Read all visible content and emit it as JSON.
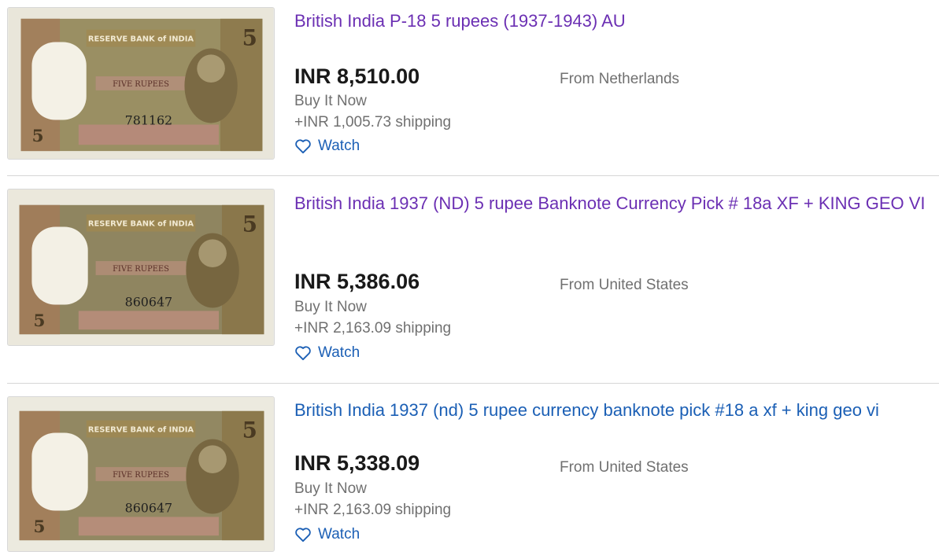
{
  "listings": [
    {
      "title": "British India P-18 5 rupees (1937-1943) AU",
      "price": "INR 8,510.00",
      "buy_format": "Buy It Now",
      "shipping": "+INR 1,005.73 shipping",
      "origin": "From Netherlands",
      "watch_label": "Watch",
      "note_bank_name": "RESERVE BANK of INDIA",
      "note_serial": "781162",
      "note_value_label": "FIVE RUPEES"
    },
    {
      "title": "British India 1937 (ND) 5 rupee Banknote Currency Pick # 18a XF + KING GEO VI",
      "price": "INR 5,386.06",
      "buy_format": "Buy It Now",
      "shipping": "+INR 2,163.09 shipping",
      "origin": "From United States",
      "watch_label": "Watch",
      "note_bank_name": "RESERVE BANK of INDIA",
      "note_serial": "860647",
      "note_value_label": "FIVE RUPEES"
    },
    {
      "title": "British India 1937 (nd) 5 rupee currency banknote pick #18 a xf + king geo vi",
      "price": "INR 5,338.09",
      "buy_format": "Buy It Now",
      "shipping": "+INR 2,163.09 shipping",
      "origin": "From United States",
      "watch_label": "Watch",
      "note_bank_name": "RESERVE BANK of INDIA",
      "note_serial": "860647",
      "note_value_label": "FIVE RUPEES"
    }
  ],
  "colors": {
    "visited_link": "#6b2fb3",
    "link": "#1b5fb5",
    "price": "#191919",
    "muted": "#707070"
  },
  "icons": {
    "watch": "heart-outline-icon"
  }
}
